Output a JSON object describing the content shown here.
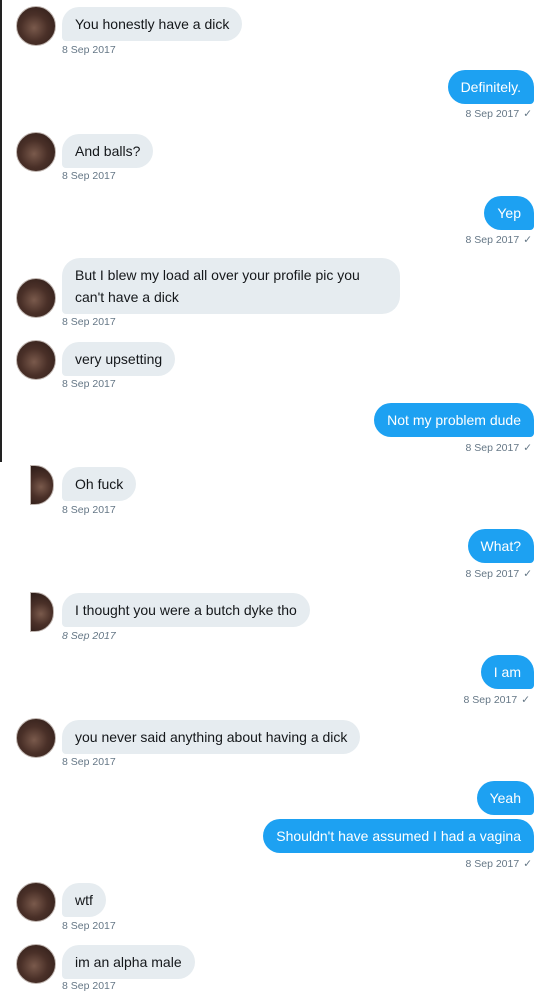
{
  "messages": [
    {
      "text": "You honestly have a dick",
      "time": "8 Sep 2017"
    },
    {
      "text": "Definitely.",
      "time": "8 Sep 2017",
      "check": "✓"
    },
    {
      "text": "And balls?",
      "time": "8 Sep 2017"
    },
    {
      "text": "Yep",
      "time": "8 Sep 2017",
      "check": "✓"
    },
    {
      "text": "But I blew my load all over your profile pic you can't have a dick",
      "time": "8 Sep 2017"
    },
    {
      "text": "very upsetting",
      "time": "8 Sep 2017"
    },
    {
      "text": "Not my problem dude",
      "time": "8 Sep 2017",
      "check": "✓"
    },
    {
      "text": "Oh fuck",
      "time": "8 Sep 2017"
    },
    {
      "text": "What?",
      "time": "8 Sep 2017",
      "check": "✓"
    },
    {
      "text": "I thought you were a butch dyke tho",
      "time": "8 Sep 2017"
    },
    {
      "text": "I am",
      "time": "8 Sep 2017",
      "check": "✓"
    },
    {
      "text": "you never said anything about having a dick",
      "time": "8 Sep 2017"
    },
    {
      "text": "Yeah",
      "time": ""
    },
    {
      "text": "Shouldn't have assumed I had a vagina",
      "time": "8 Sep 2017",
      "check": "✓"
    },
    {
      "text": "wtf",
      "time": "8 Sep 2017"
    },
    {
      "text": "im an alpha male",
      "time": "8 Sep 2017"
    }
  ]
}
